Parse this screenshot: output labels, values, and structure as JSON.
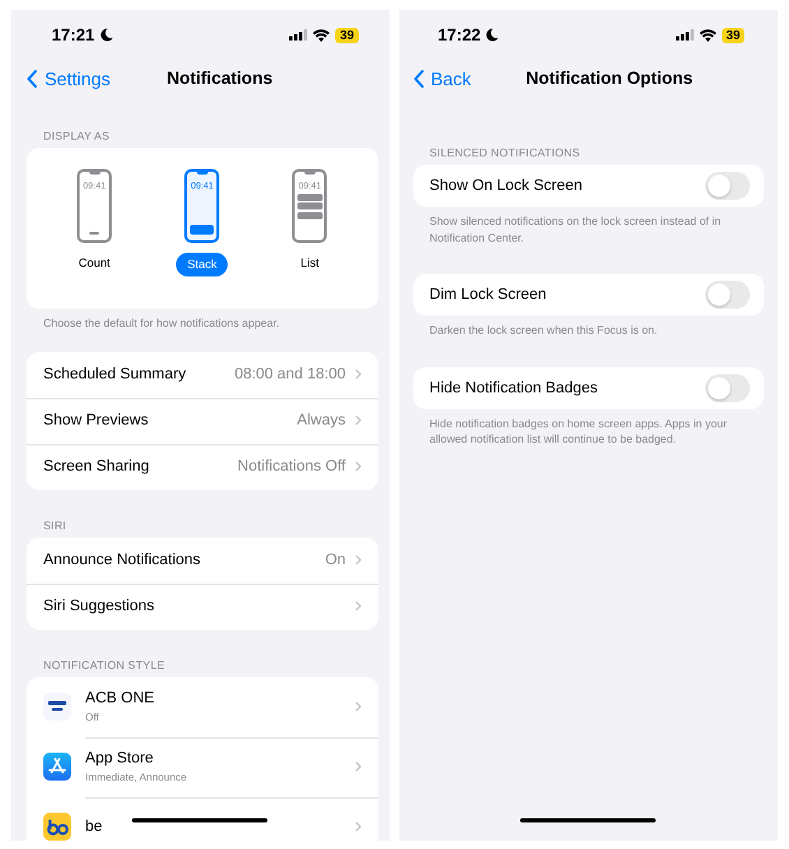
{
  "screens": [
    {
      "status_bar": {
        "time": "17:21",
        "battery": "39"
      },
      "nav": {
        "back": "Settings",
        "title": "Notifications"
      },
      "display_as": {
        "header": "DISPLAY AS",
        "options": [
          {
            "kind": "count",
            "time": "09:41",
            "label": "Count",
            "selected": false
          },
          {
            "kind": "stack",
            "time": "09:41",
            "label": "Stack",
            "selected": true
          },
          {
            "kind": "list",
            "time": "09:41",
            "label": "List",
            "selected": false
          }
        ],
        "footer": "Choose the default for how notifications appear."
      },
      "groups": [
        {
          "rows": [
            {
              "label": "Scheduled Summary",
              "value": "08:00 and 18:00"
            },
            {
              "label": "Show Previews",
              "value": "Always"
            },
            {
              "label": "Screen Sharing",
              "value": "Notifications Off"
            }
          ]
        },
        {
          "header": "SIRI",
          "rows": [
            {
              "label": "Announce Notifications",
              "value": "On"
            },
            {
              "label": "Siri Suggestions"
            }
          ]
        }
      ],
      "notification_style": {
        "header": "NOTIFICATION STYLE",
        "apps": [
          {
            "kind": "bank",
            "name": "ACB ONE",
            "detail": "Off"
          },
          {
            "kind": "store",
            "name": "App Store",
            "detail": "Immediate, Announce"
          },
          {
            "kind": "yellow",
            "name": "be"
          }
        ]
      }
    },
    {
      "status_bar": {
        "time": "17:22",
        "battery": "39"
      },
      "nav": {
        "back": "Back",
        "title": "Notification Options"
      },
      "header": "SILENCED NOTIFICATIONS",
      "toggles": [
        {
          "label": "Show On Lock Screen",
          "on": false,
          "footer": "Show silenced notifications on the lock screen instead of in Notification Center."
        },
        {
          "label": "Dim Lock Screen",
          "on": false,
          "footer": "Darken the lock screen when this Focus is on."
        },
        {
          "label": "Hide Notification Badges",
          "on": false,
          "footer": "Hide notification badges on home screen apps. Apps in your allowed notification list will continue to be badged."
        }
      ]
    }
  ]
}
